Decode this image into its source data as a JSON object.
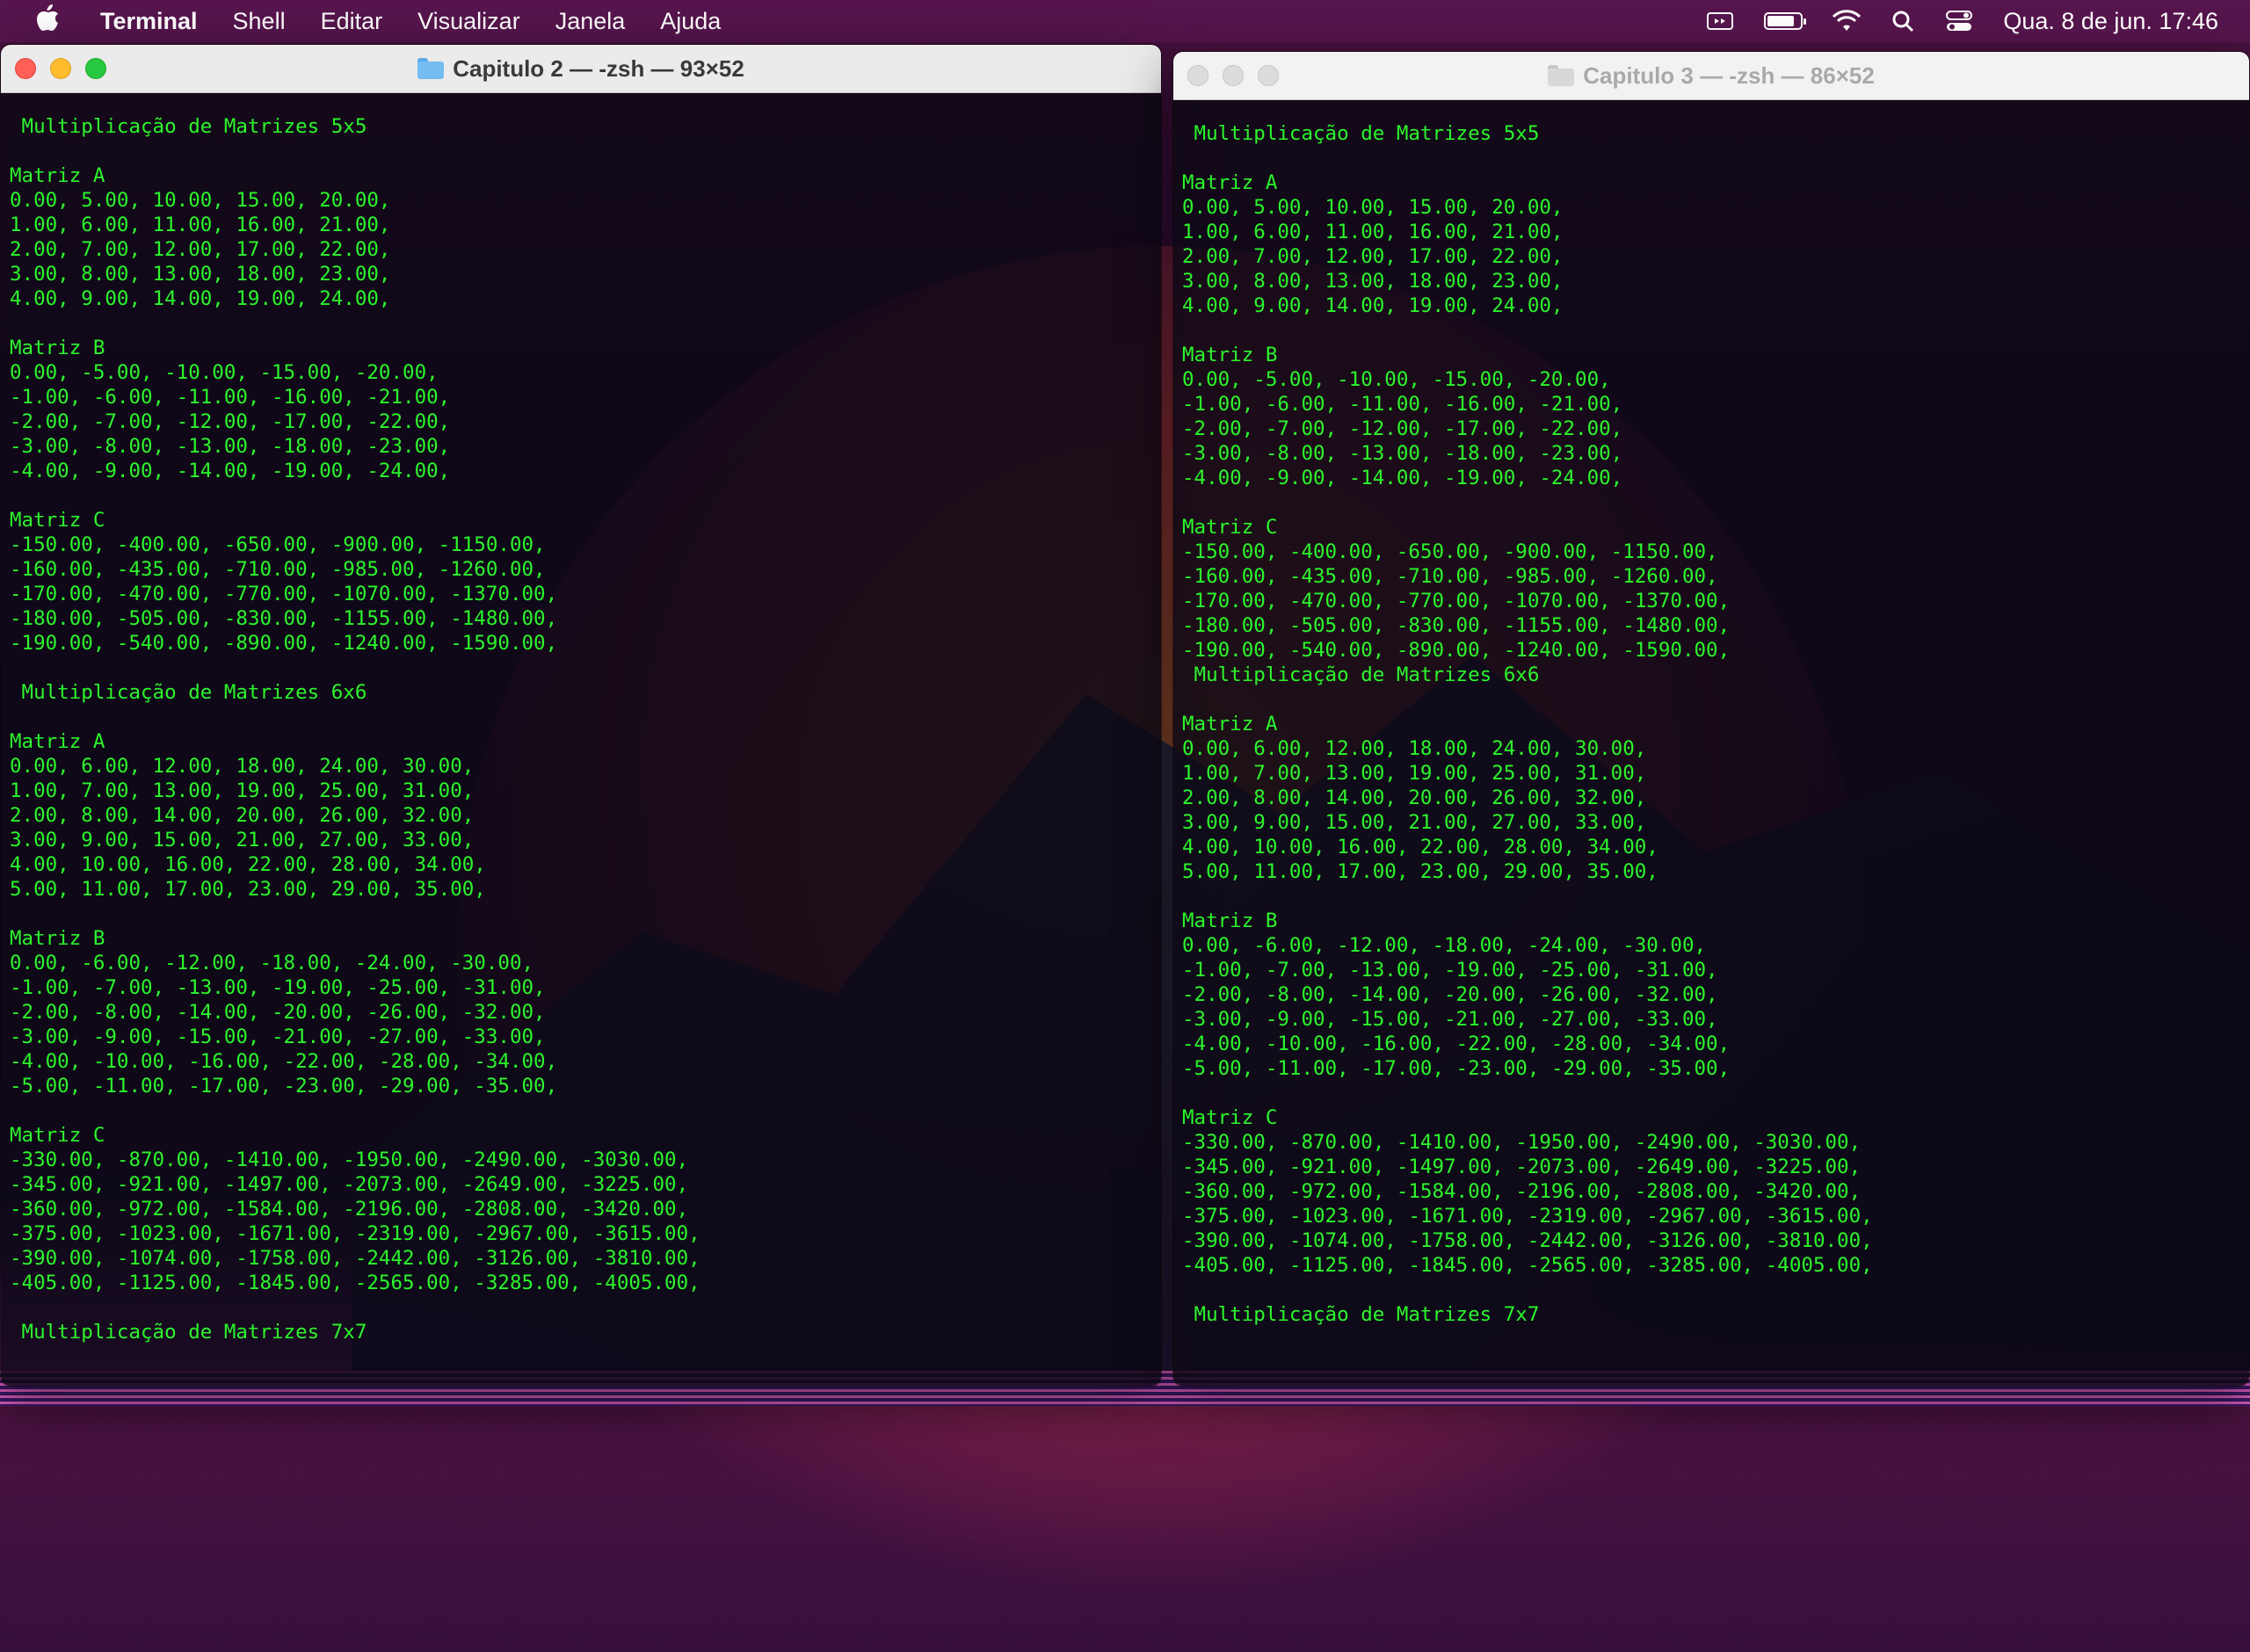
{
  "menubar": {
    "app_name": "Terminal",
    "items": [
      "Shell",
      "Editar",
      "Visualizar",
      "Janela",
      "Ajuda"
    ],
    "clock": "Qua. 8 de jun.  17:46",
    "battery_level": 0.85,
    "status_icons": [
      "display-mirroring-icon",
      "battery-icon",
      "wifi-icon",
      "spotlight-search-icon",
      "control-center-icon"
    ]
  },
  "window_left": {
    "title": "Capitulo 2 — -zsh — 93×52",
    "active": true,
    "lines": [
      " Multiplicação de Matrizes 5x5",
      "",
      "Matriz A",
      "0.00, 5.00, 10.00, 15.00, 20.00,",
      "1.00, 6.00, 11.00, 16.00, 21.00,",
      "2.00, 7.00, 12.00, 17.00, 22.00,",
      "3.00, 8.00, 13.00, 18.00, 23.00,",
      "4.00, 9.00, 14.00, 19.00, 24.00,",
      "",
      "Matriz B",
      "0.00, -5.00, -10.00, -15.00, -20.00,",
      "-1.00, -6.00, -11.00, -16.00, -21.00,",
      "-2.00, -7.00, -12.00, -17.00, -22.00,",
      "-3.00, -8.00, -13.00, -18.00, -23.00,",
      "-4.00, -9.00, -14.00, -19.00, -24.00,",
      "",
      "Matriz C",
      "-150.00, -400.00, -650.00, -900.00, -1150.00,",
      "-160.00, -435.00, -710.00, -985.00, -1260.00,",
      "-170.00, -470.00, -770.00, -1070.00, -1370.00,",
      "-180.00, -505.00, -830.00, -1155.00, -1480.00,",
      "-190.00, -540.00, -890.00, -1240.00, -1590.00,",
      "",
      " Multiplicação de Matrizes 6x6",
      "",
      "Matriz A",
      "0.00, 6.00, 12.00, 18.00, 24.00, 30.00,",
      "1.00, 7.00, 13.00, 19.00, 25.00, 31.00,",
      "2.00, 8.00, 14.00, 20.00, 26.00, 32.00,",
      "3.00, 9.00, 15.00, 21.00, 27.00, 33.00,",
      "4.00, 10.00, 16.00, 22.00, 28.00, 34.00,",
      "5.00, 11.00, 17.00, 23.00, 29.00, 35.00,",
      "",
      "Matriz B",
      "0.00, -6.00, -12.00, -18.00, -24.00, -30.00,",
      "-1.00, -7.00, -13.00, -19.00, -25.00, -31.00,",
      "-2.00, -8.00, -14.00, -20.00, -26.00, -32.00,",
      "-3.00, -9.00, -15.00, -21.00, -27.00, -33.00,",
      "-4.00, -10.00, -16.00, -22.00, -28.00, -34.00,",
      "-5.00, -11.00, -17.00, -23.00, -29.00, -35.00,",
      "",
      "Matriz C",
      "-330.00, -870.00, -1410.00, -1950.00, -2490.00, -3030.00,",
      "-345.00, -921.00, -1497.00, -2073.00, -2649.00, -3225.00,",
      "-360.00, -972.00, -1584.00, -2196.00, -2808.00, -3420.00,",
      "-375.00, -1023.00, -1671.00, -2319.00, -2967.00, -3615.00,",
      "-390.00, -1074.00, -1758.00, -2442.00, -3126.00, -3810.00,",
      "-405.00, -1125.00, -1845.00, -2565.00, -3285.00, -4005.00,",
      "",
      " Multiplicação de Matrizes 7x7"
    ]
  },
  "window_right": {
    "title": "Capitulo 3 — -zsh — 86×52",
    "active": false,
    "lines": [
      " Multiplicação de Matrizes 5x5",
      "",
      "Matriz A",
      "0.00, 5.00, 10.00, 15.00, 20.00,",
      "1.00, 6.00, 11.00, 16.00, 21.00,",
      "2.00, 7.00, 12.00, 17.00, 22.00,",
      "3.00, 8.00, 13.00, 18.00, 23.00,",
      "4.00, 9.00, 14.00, 19.00, 24.00,",
      "",
      "Matriz B",
      "0.00, -5.00, -10.00, -15.00, -20.00,",
      "-1.00, -6.00, -11.00, -16.00, -21.00,",
      "-2.00, -7.00, -12.00, -17.00, -22.00,",
      "-3.00, -8.00, -13.00, -18.00, -23.00,",
      "-4.00, -9.00, -14.00, -19.00, -24.00,",
      "",
      "Matriz C",
      "-150.00, -400.00, -650.00, -900.00, -1150.00,",
      "-160.00, -435.00, -710.00, -985.00, -1260.00,",
      "-170.00, -470.00, -770.00, -1070.00, -1370.00,",
      "-180.00, -505.00, -830.00, -1155.00, -1480.00,",
      "-190.00, -540.00, -890.00, -1240.00, -1590.00,",
      " Multiplicação de Matrizes 6x6",
      "",
      "Matriz A",
      "0.00, 6.00, 12.00, 18.00, 24.00, 30.00,",
      "1.00, 7.00, 13.00, 19.00, 25.00, 31.00,",
      "2.00, 8.00, 14.00, 20.00, 26.00, 32.00,",
      "3.00, 9.00, 15.00, 21.00, 27.00, 33.00,",
      "4.00, 10.00, 16.00, 22.00, 28.00, 34.00,",
      "5.00, 11.00, 17.00, 23.00, 29.00, 35.00,",
      "",
      "Matriz B",
      "0.00, -6.00, -12.00, -18.00, -24.00, -30.00,",
      "-1.00, -7.00, -13.00, -19.00, -25.00, -31.00,",
      "-2.00, -8.00, -14.00, -20.00, -26.00, -32.00,",
      "-3.00, -9.00, -15.00, -21.00, -27.00, -33.00,",
      "-4.00, -10.00, -16.00, -22.00, -28.00, -34.00,",
      "-5.00, -11.00, -17.00, -23.00, -29.00, -35.00,",
      "",
      "Matriz C",
      "-330.00, -870.00, -1410.00, -1950.00, -2490.00, -3030.00,",
      "-345.00, -921.00, -1497.00, -2073.00, -2649.00, -3225.00,",
      "-360.00, -972.00, -1584.00, -2196.00, -2808.00, -3420.00,",
      "-375.00, -1023.00, -1671.00, -2319.00, -2967.00, -3615.00,",
      "-390.00, -1074.00, -1758.00, -2442.00, -3126.00, -3810.00,",
      "-405.00, -1125.00, -1845.00, -2565.00, -3285.00, -4005.00,",
      "",
      " Multiplicação de Matrizes 7x7"
    ]
  },
  "colors": {
    "terminal_text": "#2cf52c",
    "menubar_bg": "#58164e"
  }
}
